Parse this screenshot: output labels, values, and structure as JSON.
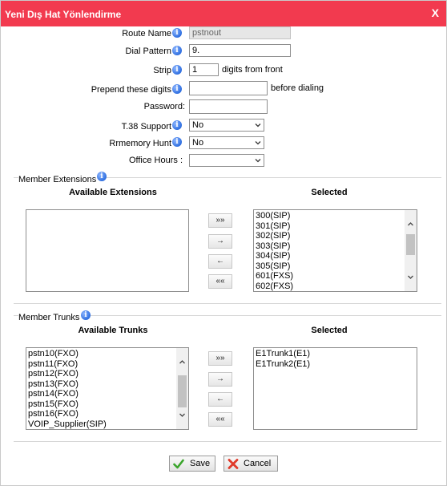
{
  "dialog": {
    "title": "Yeni Dış Hat Yönlendirme",
    "close_label": "X"
  },
  "form": {
    "route_name": {
      "label": "Route Name",
      "value": "pstnout"
    },
    "dial_pattern": {
      "label": "Dial Pattern",
      "value": "9."
    },
    "strip": {
      "label": "Strip",
      "value": "1",
      "suffix": "digits from front"
    },
    "prepend": {
      "label": "Prepend these digits",
      "value": "",
      "suffix": "before dialing"
    },
    "password": {
      "label": "Password:",
      "value": ""
    },
    "t38": {
      "label": "T.38 Support",
      "value": "No"
    },
    "rrmemory": {
      "label": "Rrmemory Hunt",
      "value": "No"
    },
    "office_hours": {
      "label": "Office Hours :",
      "value": ""
    }
  },
  "extensions": {
    "title": "Member Extensions",
    "available_header": "Available Extensions",
    "selected_header": "Selected",
    "available": [],
    "selected": [
      "300(SIP)",
      "301(SIP)",
      "302(SIP)",
      "303(SIP)",
      "304(SIP)",
      "305(SIP)",
      "601(FXS)",
      "602(FXS)"
    ]
  },
  "trunks": {
    "title": "Member Trunks",
    "available_header": "Available Trunks",
    "selected_header": "Selected",
    "available": [
      "pstn10(FXO)",
      "pstn11(FXO)",
      "pstn12(FXO)",
      "pstn13(FXO)",
      "pstn14(FXO)",
      "pstn15(FXO)",
      "pstn16(FXO)",
      "VOIP_Supplier(SIP)"
    ],
    "selected": [
      "E1Trunk1(E1)",
      "E1Trunk2(E1)"
    ]
  },
  "move_buttons": {
    "add_all": "»»",
    "add": "→",
    "remove": "←",
    "remove_all": "««"
  },
  "actions": {
    "save": "Save",
    "cancel": "Cancel"
  },
  "icons": {
    "info": "info-icon",
    "save": "check-icon",
    "cancel": "x-icon"
  },
  "colors": {
    "titlebar": "#f23a4f",
    "save_check": "#3aa52b",
    "cancel_x": "#e03a2a"
  }
}
